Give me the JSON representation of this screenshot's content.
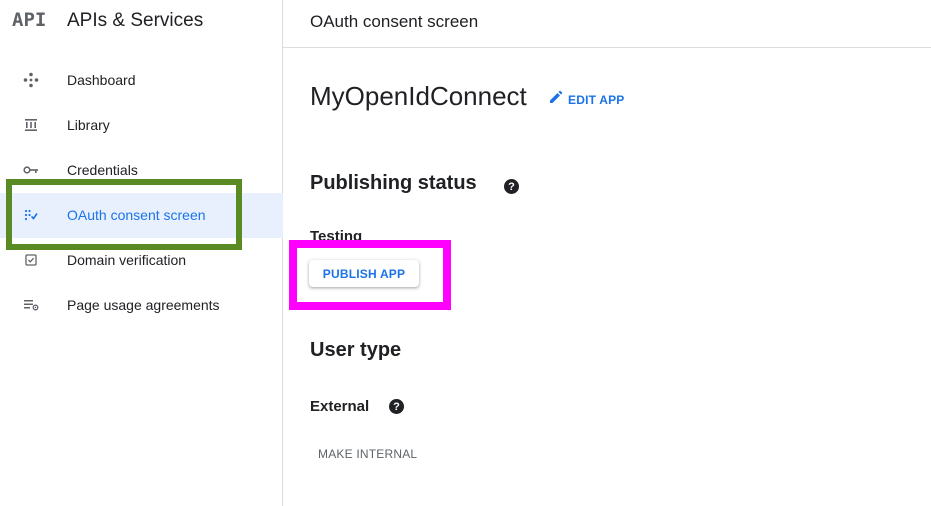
{
  "sidebar": {
    "logo": "API",
    "title": "APIs & Services",
    "items": [
      {
        "label": "Dashboard",
        "icon": "dashboard-icon"
      },
      {
        "label": "Library",
        "icon": "library-icon"
      },
      {
        "label": "Credentials",
        "icon": "key-icon"
      },
      {
        "label": "OAuth consent screen",
        "icon": "consent-icon",
        "active": true
      },
      {
        "label": "Domain verification",
        "icon": "checkbox-icon"
      },
      {
        "label": "Page usage agreements",
        "icon": "settings-list-icon"
      }
    ]
  },
  "header": {
    "title": "OAuth consent screen"
  },
  "main": {
    "app_name": "MyOpenIdConnect",
    "edit_app_label": "EDIT APP",
    "publishing_status_title": "Publishing status",
    "publishing_status_value": "Testing",
    "publish_button_label": "PUBLISH APP",
    "user_type_title": "User type",
    "user_type_value": "External",
    "make_internal_label": "MAKE INTERNAL",
    "help_glyph": "?"
  },
  "colors": {
    "accent": "#1a73e8",
    "active_bg": "#e8f0fe",
    "highlight_green": "#5a8a23",
    "highlight_magenta": "#ff00ff"
  }
}
